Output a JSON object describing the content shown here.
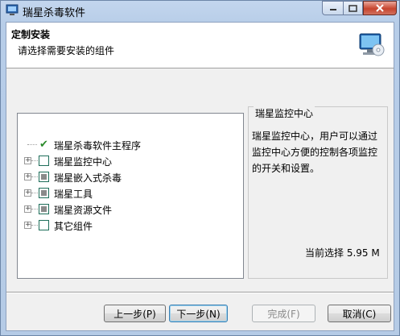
{
  "window": {
    "title": "瑞星杀毒软件"
  },
  "header": {
    "title": "定制安装",
    "subtitle": "请选择需要安装的组件",
    "icon": "monitor-cd-icon"
  },
  "tree": {
    "items": [
      {
        "label": "瑞星杀毒软件主程序",
        "state": "required",
        "expandable": false
      },
      {
        "label": "瑞星监控中心",
        "state": "unchecked",
        "expandable": true
      },
      {
        "label": "瑞星嵌入式杀毒",
        "state": "partial",
        "expandable": true
      },
      {
        "label": "瑞星工具",
        "state": "partial",
        "expandable": true
      },
      {
        "label": "瑞星资源文件",
        "state": "partial",
        "expandable": true
      },
      {
        "label": "其它组件",
        "state": "unchecked",
        "expandable": true
      }
    ]
  },
  "description": {
    "legend": "瑞星监控中心",
    "text": "瑞星监控中心，用户可以通过监控中心方便的控制各项监控的开关和设置。",
    "selection_size": "当前选择 5.95 M"
  },
  "buttons": {
    "back": "上一步(P)",
    "next": "下一步(N)",
    "finish": "完成(F)",
    "cancel": "取消(C)"
  }
}
